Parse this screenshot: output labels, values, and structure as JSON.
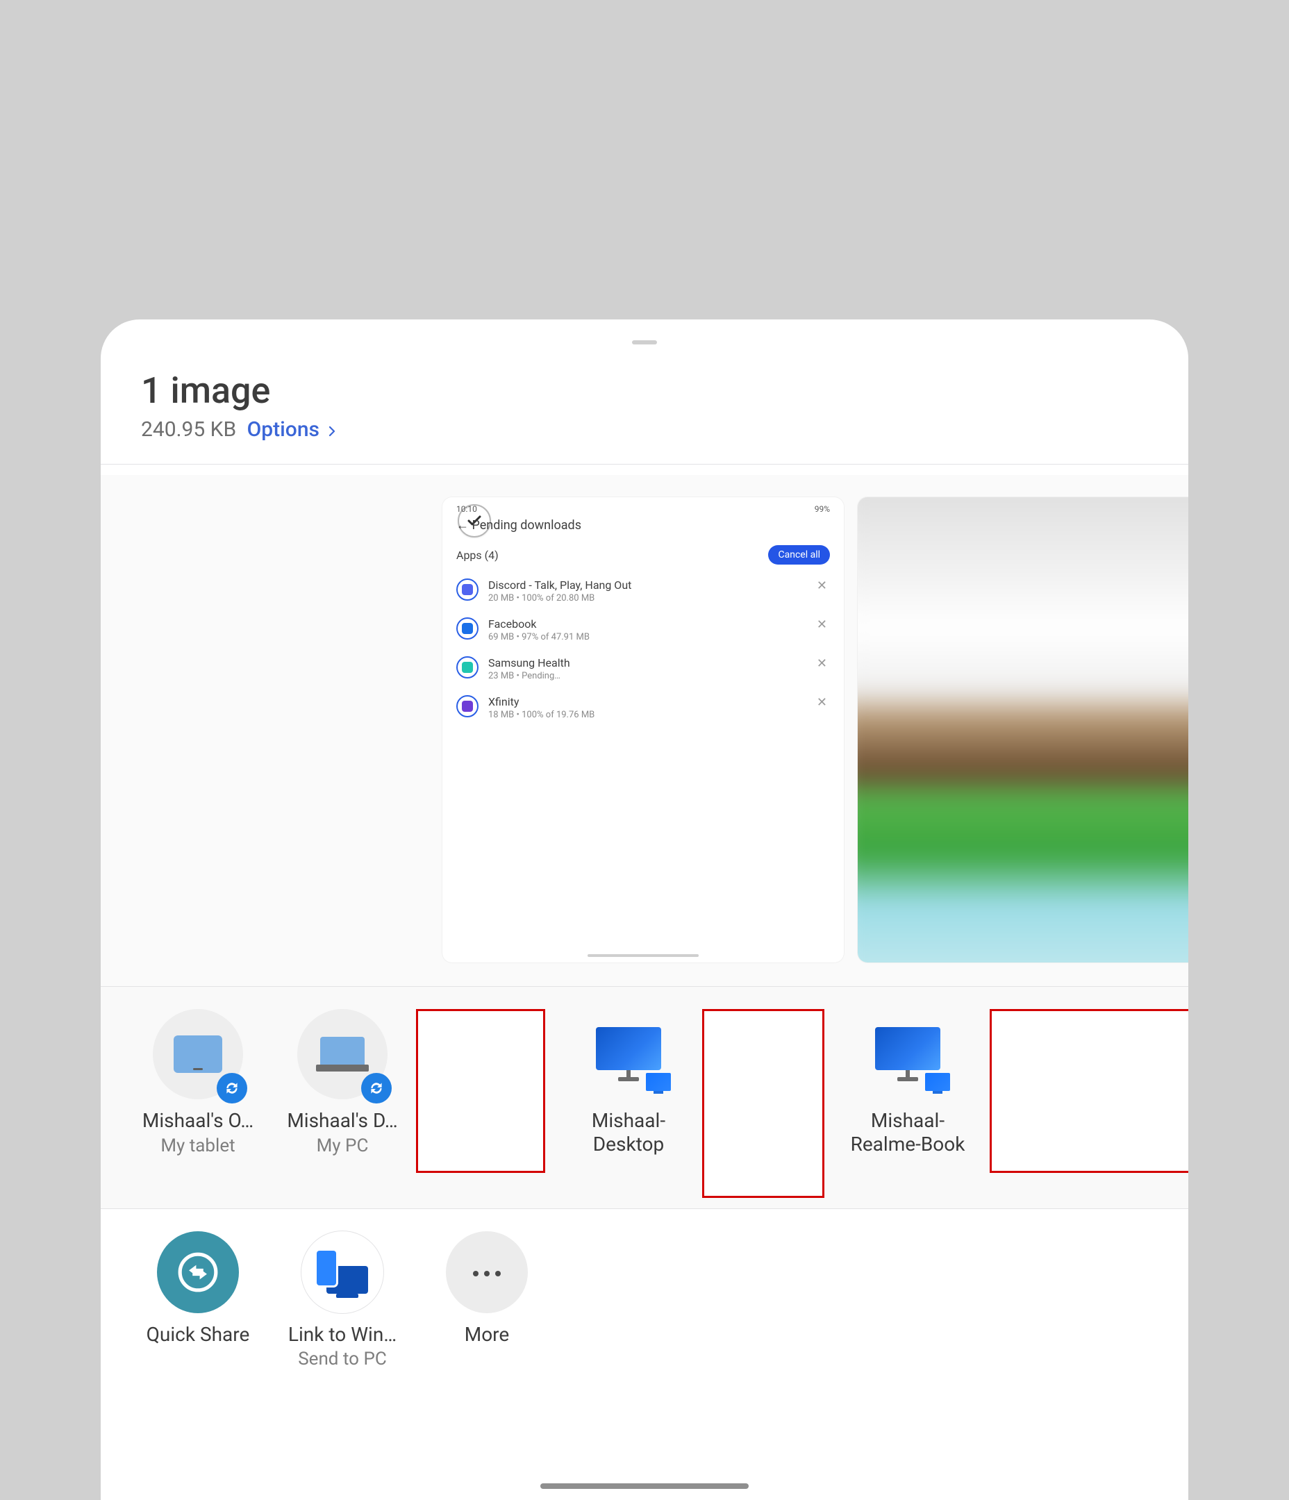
{
  "header": {
    "title": "1 image",
    "size": "240.95 KB",
    "options_label": "Options"
  },
  "preview": {
    "selected_screenshot": {
      "status_time": "10:10",
      "status_right": "99%",
      "screen_title": "Pending downloads",
      "apps_label": "Apps (4)",
      "cancel_all": "Cancel all",
      "items": [
        {
          "name": "Discord - Talk, Play, Hang Out",
          "sub": "20 MB  •  100% of 20.80 MB",
          "icon_color": "#5165f0"
        },
        {
          "name": "Facebook",
          "sub": "69 MB  •  97% of 47.91 MB",
          "icon_color": "#1a6fe8"
        },
        {
          "name": "Samsung Health",
          "sub": "23 MB  •  Pending…",
          "icon_color": "#21c6b0"
        },
        {
          "name": "Xfinity",
          "sub": "18 MB  •  100% of 19.76 MB",
          "icon_color": "#6e3dd6"
        }
      ]
    }
  },
  "devices": {
    "items": [
      {
        "name": "Mishaal's O…",
        "sub": "My tablet",
        "kind": "tablet"
      },
      {
        "name": "Mishaal's D…",
        "sub": "My PC",
        "kind": "laptop"
      },
      {
        "placeholder": true
      },
      {
        "name": "Mishaal-Desktop",
        "kind": "desktop"
      },
      {
        "placeholder": true,
        "wide": true
      },
      {
        "name": "Mishaal-Realme-Book",
        "kind": "desktop"
      },
      {
        "placeholder": true,
        "extra_wide": true
      }
    ]
  },
  "actions": {
    "quick_share": "Quick Share",
    "link_to_windows": "Link to Win…",
    "link_to_windows_sub": "Send to PC",
    "more": "More"
  }
}
